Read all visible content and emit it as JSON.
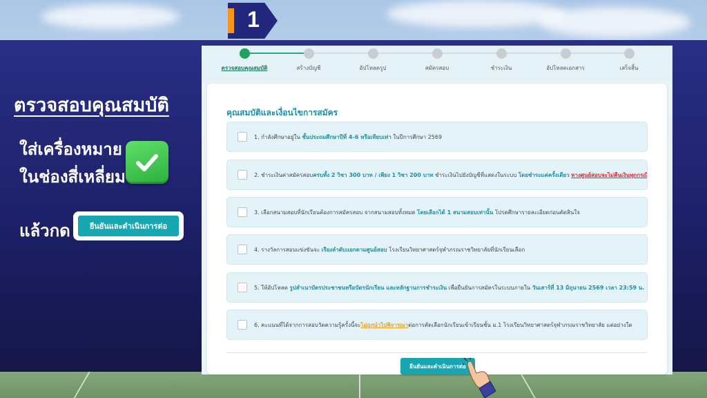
{
  "step_badge": {
    "number": "1"
  },
  "instructions": {
    "title": "ตรวจสอบคุณสมบัติ",
    "line1": "ใส่เครื่องหมาย",
    "line2": "ในช่องสี่เหลี่ยม",
    "line3": "แล้วกด",
    "demo_button": "ยืนยันและดำเนินการต่อ",
    "check_icon": "green-checkmark-icon"
  },
  "stepper": {
    "steps": [
      {
        "label": "ตรวจสอบคุณสมบัติ",
        "active": true
      },
      {
        "label": "สร้างบัญชี",
        "active": false
      },
      {
        "label": "อัปโหลดรูป",
        "active": false
      },
      {
        "label": "สมัครสอบ",
        "active": false
      },
      {
        "label": "ชำระเงิน",
        "active": false
      },
      {
        "label": "อัปโหลดเอกสาร",
        "active": false
      },
      {
        "label": "เสร็จสิ้น",
        "active": false
      }
    ]
  },
  "form": {
    "title": "คุณสมบัติและเงื่อนไขการสมัคร",
    "conditions": [
      {
        "parts": [
          {
            "t": "1. กำลังศึกษาอยู่ใน ",
            "s": ""
          },
          {
            "t": "ชั้นประถมศึกษาปีที่ 4-6 หรือเทียบเท่า",
            "s": "hl"
          },
          {
            "t": " ในปีการศึกษา 2569",
            "s": ""
          }
        ]
      },
      {
        "parts": [
          {
            "t": "2. ชำระเงินค่าสมัครสอบ",
            "s": ""
          },
          {
            "t": "ครบทั้ง 2 วิชา 300 บาท / เพียง 1 วิชา 200 บาท",
            "s": "hl"
          },
          {
            "t": " ชำระเงินไปยังบัญชีที่แสดงในระบบ ",
            "s": ""
          },
          {
            "t": "โดยชำระแค่ครั้งเดียว",
            "s": "hl"
          },
          {
            "t": " ",
            "s": ""
          },
          {
            "t": "ทางศูนย์สอบจะไม่คืนเงินทุกกรณี",
            "s": "red"
          }
        ]
      },
      {
        "parts": [
          {
            "t": "3. เลือกสนามสอบที่นักเรียนต้องการสมัครสอบ จากสนามสอบทั้งหมด ",
            "s": ""
          },
          {
            "t": "โดยเลือกได้ 1 สนามสอบเท่านั้น",
            "s": "hl"
          },
          {
            "t": " โปรดศึกษารายละเอียดก่อนตัดสินใจ",
            "s": ""
          }
        ]
      },
      {
        "parts": [
          {
            "t": "4. รางวัลการสอบแข่งขันจะ ",
            "s": ""
          },
          {
            "t": "เรียงลำดับแยกตามศูนย์สอบ",
            "s": "hl"
          },
          {
            "t": " โรงเรียนวิทยาศาสตร์จุฬาภรณราชวิทยาลัยที่นักเรียนเลือก",
            "s": ""
          }
        ]
      },
      {
        "parts": [
          {
            "t": "5. ให้อัปโหลด ",
            "s": ""
          },
          {
            "t": "รูปสำเนาบัตรประชาชนหรือบัตรนักเรียน และหลักฐานการชำระเงิน",
            "s": "hl"
          },
          {
            "t": " เพื่อยืนยันการสมัครในระบบภายใน ",
            "s": ""
          },
          {
            "t": "วันเสาร์ที่ 13 มิถุนายน 2569 เวลา 23:59 น.",
            "s": "hl"
          }
        ]
      },
      {
        "parts": [
          {
            "t": "6. คะแนนที่ได้จากการสอบวัดความรู้ครั้งนี้จะ",
            "s": ""
          },
          {
            "t": "ไม่ถูกนำไปพิจารณา",
            "s": "gold"
          },
          {
            "t": "ต่อการคัดเลือกนักเรียนเข้าเรียนชั้น ม.1 โรงเรียนวิทยาศาสตร์จุฬาภรณราชวิทยาลัย แต่อย่างใด",
            "s": ""
          }
        ]
      }
    ],
    "submit_label": "ยืนยันและดำเนินการต่อ",
    "cursor_icon": "hand-click-icon"
  }
}
